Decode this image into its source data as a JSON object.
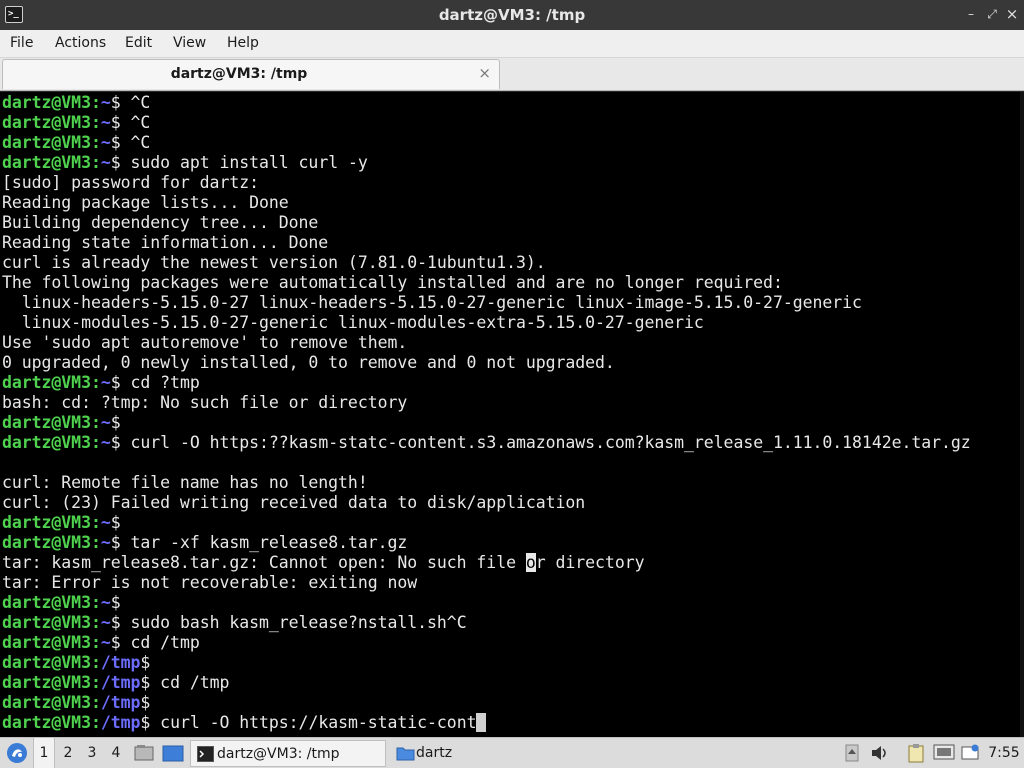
{
  "window": {
    "title": "dartz@VM3: /tmp",
    "controls": {
      "minimize": "–",
      "restore": "⤢",
      "close": "×"
    }
  },
  "menubar": {
    "items": [
      "File",
      "Actions",
      "Edit",
      "View",
      "Help"
    ]
  },
  "tabs": [
    {
      "label": "dartz@VM3: /tmp",
      "close": "×",
      "active": true
    }
  ],
  "terminal": {
    "colors": {
      "user_host": "#4fd34f",
      "path": "#6c6cff",
      "text": "#e8e8e8",
      "background": "#000000"
    },
    "lines": [
      {
        "type": "prompt",
        "user": "dartz@VM3",
        "path": "~",
        "cmd": " ^C"
      },
      {
        "type": "prompt",
        "user": "dartz@VM3",
        "path": "~",
        "cmd": " ^C"
      },
      {
        "type": "prompt",
        "user": "dartz@VM3",
        "path": "~",
        "cmd": " ^C"
      },
      {
        "type": "prompt",
        "user": "dartz@VM3",
        "path": "~",
        "cmd": " sudo apt install curl -y"
      },
      {
        "type": "out",
        "text": "[sudo] password for dartz:"
      },
      {
        "type": "out",
        "text": "Reading package lists... Done"
      },
      {
        "type": "out",
        "text": "Building dependency tree... Done"
      },
      {
        "type": "out",
        "text": "Reading state information... Done"
      },
      {
        "type": "out",
        "text": "curl is already the newest version (7.81.0-1ubuntu1.3)."
      },
      {
        "type": "out",
        "text": "The following packages were automatically installed and are no longer required:"
      },
      {
        "type": "out",
        "text": "  linux-headers-5.15.0-27 linux-headers-5.15.0-27-generic linux-image-5.15.0-27-generic"
      },
      {
        "type": "out",
        "text": "  linux-modules-5.15.0-27-generic linux-modules-extra-5.15.0-27-generic"
      },
      {
        "type": "out",
        "text": "Use 'sudo apt autoremove' to remove them."
      },
      {
        "type": "out",
        "text": "0 upgraded, 0 newly installed, 0 to remove and 0 not upgraded."
      },
      {
        "type": "prompt",
        "user": "dartz@VM3",
        "path": "~",
        "cmd": " cd ?tmp"
      },
      {
        "type": "out",
        "text": "bash: cd: ?tmp: No such file or directory"
      },
      {
        "type": "prompt",
        "user": "dartz@VM3",
        "path": "~",
        "cmd": ""
      },
      {
        "type": "prompt",
        "user": "dartz@VM3",
        "path": "~",
        "cmd": " curl -O https:??kasm-statc-content.s3.amazonaws.com?kasm_release_1.11.0.18142e.tar.gz"
      },
      {
        "type": "out",
        "text": ""
      },
      {
        "type": "out",
        "text": "curl: Remote file name has no length!"
      },
      {
        "type": "out",
        "text": "curl: (23) Failed writing received data to disk/application"
      },
      {
        "type": "prompt",
        "user": "dartz@VM3",
        "path": "~",
        "cmd": ""
      },
      {
        "type": "prompt",
        "user": "dartz@VM3",
        "path": "~",
        "cmd": " tar -xf kasm_release8.tar.gz"
      },
      {
        "type": "out_cursor",
        "before": "tar: kasm_release8.tar.gz: Cannot open: No such file ",
        "cursor": "o",
        "after": "r directory"
      },
      {
        "type": "out",
        "text": "tar: Error is not recoverable: exiting now"
      },
      {
        "type": "prompt",
        "user": "dartz@VM3",
        "path": "~",
        "cmd": ""
      },
      {
        "type": "prompt",
        "user": "dartz@VM3",
        "path": "~",
        "cmd": " sudo bash kasm_release?nstall.sh^C"
      },
      {
        "type": "prompt",
        "user": "dartz@VM3",
        "path": "~",
        "cmd": " cd /tmp"
      },
      {
        "type": "prompt",
        "user": "dartz@VM3",
        "path": "/tmp",
        "cmd": ""
      },
      {
        "type": "prompt",
        "user": "dartz@VM3",
        "path": "/tmp",
        "cmd": " cd /tmp"
      },
      {
        "type": "prompt",
        "user": "dartz@VM3",
        "path": "/tmp",
        "cmd": ""
      },
      {
        "type": "prompt",
        "user": "dartz@VM3",
        "path": "/tmp",
        "cmd": " curl -O https://kasm-static-cont",
        "block_cursor": true
      }
    ]
  },
  "taskbar": {
    "workspaces": [
      "1",
      "2",
      "3",
      "4"
    ],
    "active_workspace": "1",
    "tasks": [
      {
        "label": "dartz@VM3: /tmp",
        "icon": "terminal-icon",
        "active": true
      },
      {
        "label": "dartz",
        "icon": "folder-icon",
        "active": false
      }
    ],
    "clock": "7:55"
  }
}
